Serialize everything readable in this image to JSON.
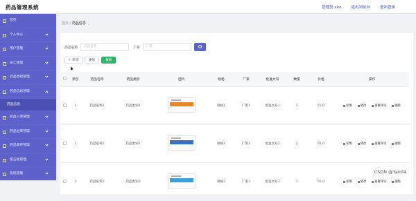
{
  "app": {
    "title": "药品管理系统"
  },
  "header": {
    "links": [
      "管理员 abo",
      "退出到前台",
      "退出登录"
    ]
  },
  "sidebar": {
    "items": [
      {
        "label": "首页",
        "open": false
      },
      {
        "label": "个人中心",
        "open": false
      },
      {
        "label": "用户管理",
        "open": false
      },
      {
        "label": "员工管理",
        "open": false
      },
      {
        "label": "药品类别管理",
        "open": false
      },
      {
        "label": "药品信息管理",
        "open": true
      },
      {
        "label": "药品信息",
        "sub": true
      },
      {
        "label": "药品入库管理",
        "open": false
      },
      {
        "label": "药品出库管理",
        "open": false
      },
      {
        "label": "药品库存管理",
        "open": false
      },
      {
        "label": "留言板管理",
        "open": false
      },
      {
        "label": "系统管理",
        "open": false
      }
    ]
  },
  "breadcrumb": {
    "home": "首页",
    "sep": "/",
    "current": "药品信息"
  },
  "search": {
    "label1": "药品名称",
    "placeholder1": "药品名称",
    "label2": "厂家",
    "placeholder2": "厂家"
  },
  "actions": {
    "add": "+ 新增",
    "delete": "删除",
    "report": "报表"
  },
  "table": {
    "headers": [
      "",
      "索引",
      "药品名称",
      "药品类别",
      "图片",
      "规格",
      "厂家",
      "批准文号",
      "数量",
      "价格",
      "操作"
    ],
    "rows": [
      {
        "idx": "1",
        "name": "药品名称1",
        "cat": "药品类别1",
        "spec": "规格1",
        "mfr": "厂家1",
        "lic": "批准文号1",
        "qty": "1",
        "price": "55.0",
        "band": "#e8862a"
      },
      {
        "idx": "2",
        "name": "药品名称2",
        "cat": "药品类别2",
        "spec": "规格2",
        "mfr": "厂家2",
        "lic": "批准文号2",
        "qty": "2",
        "price": "55.0",
        "band": "#3b6fc0"
      },
      {
        "idx": "3",
        "name": "药品名称3",
        "cat": "药品类别3",
        "spec": "规格3",
        "mfr": "厂家3",
        "lic": "批准文号3",
        "qty": "3",
        "price": "55.0",
        "band": "#3aa0d8"
      }
    ],
    "ops": [
      "详情",
      "修改",
      "查看评论",
      "删除"
    ]
  },
  "watermark": "CSDN @Yaml4"
}
